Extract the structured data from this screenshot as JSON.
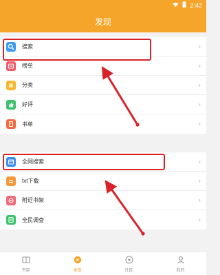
{
  "status_bar": {
    "time": "2:42",
    "wifi_icon": "wifi-icon",
    "battery_icon": "battery-icon"
  },
  "app_bar": {
    "title": "发现"
  },
  "group1": [
    {
      "key": "search",
      "label": "搜索",
      "icon": "search-icon",
      "color": "#3d9cf2"
    },
    {
      "key": "rank",
      "label": "榜单",
      "icon": "ranking-icon",
      "color": "#f15a6a"
    },
    {
      "key": "category",
      "label": "分类",
      "icon": "category-list-icon",
      "color": "#f5b82e"
    },
    {
      "key": "good-reviews",
      "label": "好评",
      "icon": "thumbs-up-icon",
      "color": "#3cc36b"
    },
    {
      "key": "booklist",
      "label": "书单",
      "icon": "booklist-icon",
      "color": "#f26a3c"
    }
  ],
  "group2": [
    {
      "key": "web-search",
      "label": "全网搜索",
      "icon": "web-search-icon",
      "color": "#3d8ef2"
    },
    {
      "key": "txt-download",
      "label": "txt下载",
      "icon": "download-icon",
      "color": "#f59a3c"
    },
    {
      "key": "nearby-shelf",
      "label": "附近书架",
      "icon": "nearby-shelf-icon",
      "color": "#ef6a7a"
    },
    {
      "key": "survey",
      "label": "全民调查",
      "icon": "survey-icon",
      "color": "#3cc36b"
    }
  ],
  "bottom_nav": [
    {
      "key": "bookshelf",
      "label": "书架",
      "icon": "bookshelf-icon",
      "active": false
    },
    {
      "key": "discover",
      "label": "发现",
      "icon": "discover-icon",
      "active": true
    },
    {
      "key": "community",
      "label": "社区",
      "icon": "community-icon",
      "active": false
    },
    {
      "key": "mine",
      "label": "我的",
      "icon": "profile-icon",
      "active": false
    }
  ],
  "colors": {
    "accent": "#f5a52a",
    "annotation": "#d8232a"
  }
}
